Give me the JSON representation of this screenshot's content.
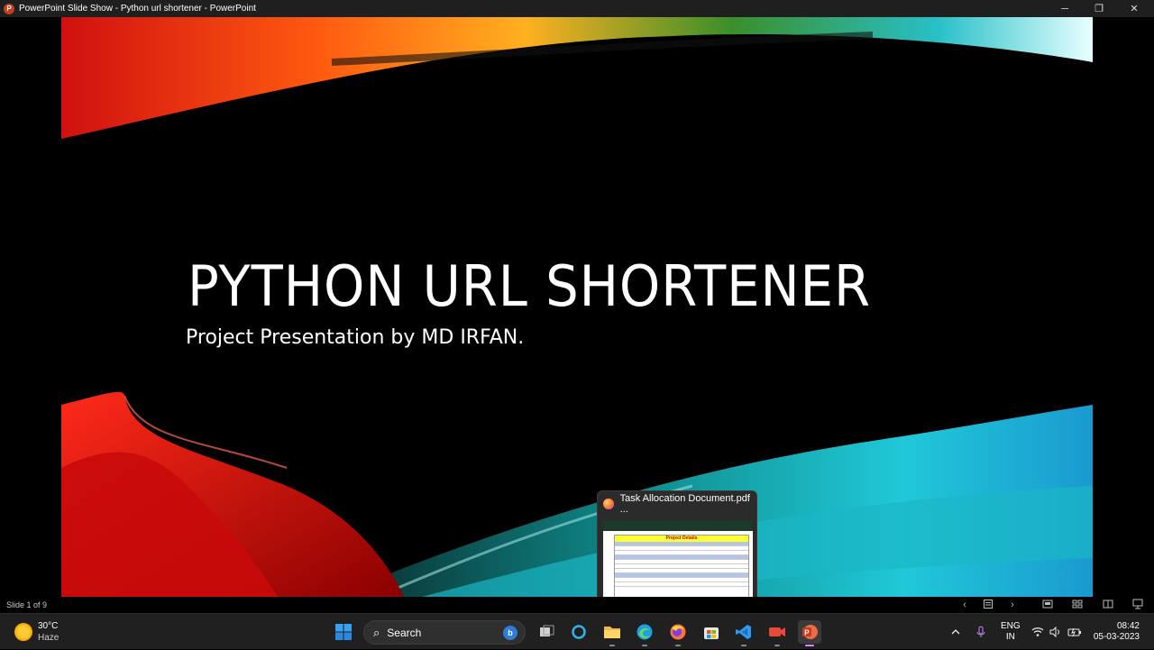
{
  "window": {
    "title": "PowerPoint Slide Show  -  Python url shortener - PowerPoint",
    "app_icon_letter": "P",
    "minimize": "─",
    "restore": "❐",
    "close": "✕"
  },
  "slide": {
    "title": "PYTHON URL SHORTENER",
    "subtitle": "Project Presentation by MD IRFAN."
  },
  "thumbnail": {
    "title": "Task Allocation Document.pdf ...",
    "doc_heading": "Project Details"
  },
  "statusbar": {
    "slide_counter": "Slide 1 of 9",
    "prev": "‹",
    "next": "›"
  },
  "taskbar": {
    "weather_temp": "30°C",
    "weather_condition": "Haze",
    "search_placeholder": "Search",
    "bing_letter": "b",
    "lang_line1": "ENG",
    "lang_line2": "IN",
    "time": "08:42",
    "date": "05-03-2023"
  },
  "colors": {
    "powerpoint": "#c43e1c",
    "vscode": "#2b9af3",
    "edge": "#1fa0e0",
    "cortana": "#2fb4e8",
    "explorer": "#f2b84b"
  }
}
